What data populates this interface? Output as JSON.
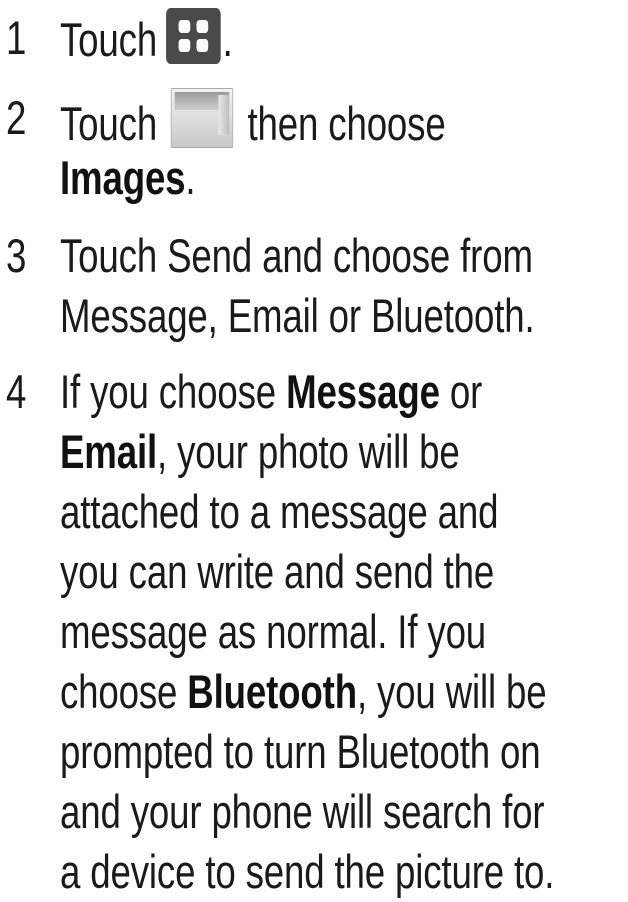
{
  "steps": [
    {
      "number": "1",
      "prefix": "Touch",
      "icon": "apps-grid-icon",
      "suffix": "."
    },
    {
      "number": "2",
      "prefix": "Touch",
      "icon": "gallery-icon",
      "suffix": "then choose",
      "line2_bold": "Images",
      "line2_end": "."
    },
    {
      "number": "3",
      "line1": "Touch Send and choose from",
      "line2": "Message, Email or Bluetooth."
    },
    {
      "number": "4",
      "l1_a": "If you choose ",
      "l1_b": "Message",
      "l1_c": " or",
      "l2_b": "Email",
      "l2_c": ", your photo will be",
      "l3": "attached to a message and",
      "l4": "you can write and send the",
      "l5": "message as normal. If you",
      "l6_a": "choose ",
      "l6_b": "Bluetooth",
      "l6_c": ", you will be",
      "l7": "prompted to turn Bluetooth on",
      "l8": "and your phone will search for",
      "l9": "a device to send the picture to."
    }
  ]
}
